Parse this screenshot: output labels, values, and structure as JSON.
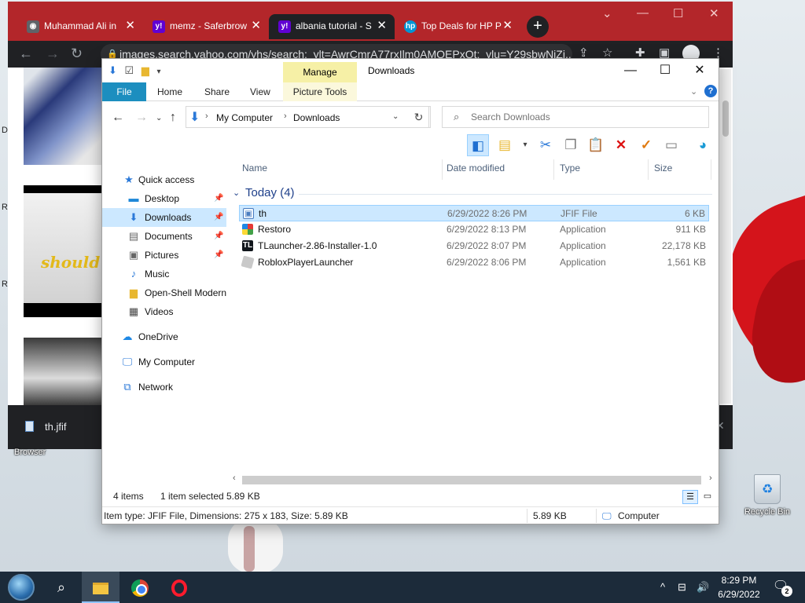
{
  "browser": {
    "tabs": [
      {
        "label": "Muhammad Ali in",
        "favicon": "globe-icon"
      },
      {
        "label": "memz - Saferbrow",
        "favicon": "yahoo-icon"
      },
      {
        "label": "albania tutorial - S",
        "favicon": "yahoo-icon",
        "active": true
      },
      {
        "label": "Top Deals for HP P",
        "favicon": "hp-icon"
      }
    ],
    "url": "images.search.yahoo.com/yhs/search;_ylt=AwrCmrA77rxIlm0AMQEPxQt;_ylu=Y29sbwNiZj...",
    "download_file": "th.jfif",
    "tab_bar_color": "#b3262a"
  },
  "desktop": {
    "left_labels": [
      "D",
      "R",
      "R"
    ],
    "browser_label": "Browser",
    "recycle_bin_label": "Recycle Bin"
  },
  "explorer": {
    "title": "Downloads",
    "manage_tab": "Manage",
    "ribbon_tabs": {
      "file": "File",
      "home": "Home",
      "share": "Share",
      "view": "View",
      "picture_tools": "Picture Tools"
    },
    "breadcrumb": [
      "My Computer",
      "Downloads"
    ],
    "search_placeholder": "Search Downloads",
    "nav": {
      "quick_access": "Quick access",
      "desktop": "Desktop",
      "downloads": "Downloads",
      "documents": "Documents",
      "pictures": "Pictures",
      "music": "Music",
      "open_shell": "Open-Shell Modern",
      "videos": "Videos",
      "onedrive": "OneDrive",
      "my_computer": "My Computer",
      "network": "Network"
    },
    "columns": {
      "name": "Name",
      "date": "Date modified",
      "type": "Type",
      "size": "Size"
    },
    "group_label": "Today (4)",
    "files": [
      {
        "name": "th",
        "date": "6/29/2022 8:26 PM",
        "type": "JFIF File",
        "size": "6 KB",
        "icon": "image-file-icon",
        "selected": true
      },
      {
        "name": "Restoro",
        "date": "6/29/2022 8:13 PM",
        "type": "Application",
        "size": "911 KB",
        "icon": "restoro-app-icon"
      },
      {
        "name": "TLauncher-2.86-Installer-1.0",
        "date": "6/29/2022 8:07 PM",
        "type": "Application",
        "size": "22,178 KB",
        "icon": "tlauncher-app-icon"
      },
      {
        "name": "RobloxPlayerLauncher",
        "date": "6/29/2022 8:06 PM",
        "type": "Application",
        "size": "1,561 KB",
        "icon": "roblox-app-icon"
      }
    ],
    "status": {
      "items": "4 items",
      "selected": "1 item selected",
      "selected_size": "5.89 KB"
    },
    "details": {
      "info": "Item type: JFIF File, Dimensions: 275 x 183, Size: 5.89 KB",
      "size": "5.89 KB",
      "location": "Computer"
    },
    "accent_color": "#1c8ebf",
    "selection_color": "#cce8ff"
  },
  "taskbar": {
    "time": "8:29 PM",
    "date": "6/29/2022",
    "notification_count": "2",
    "apps": [
      "file-explorer-icon",
      "chrome-icon",
      "opera-icon"
    ]
  }
}
